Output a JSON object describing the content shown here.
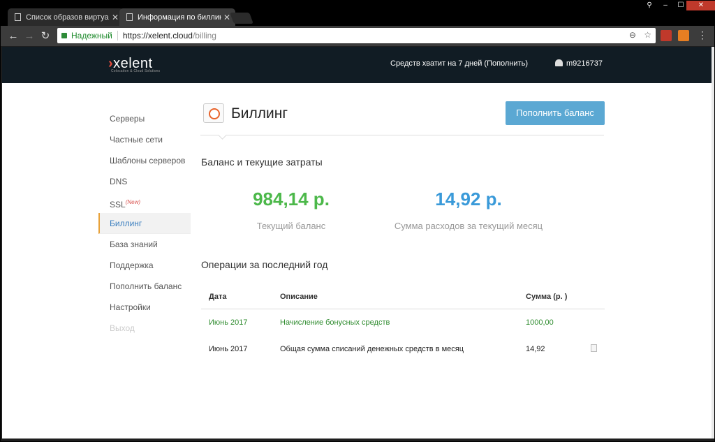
{
  "browser": {
    "tabs": [
      {
        "title": "Список образов виртуа"
      },
      {
        "title": "Информация по биллинг"
      }
    ],
    "secure_label": "Надежный",
    "url_host": "https://xelent.cloud",
    "url_path": "/billing"
  },
  "site": {
    "logo": "xelent",
    "logo_sub": "Colocation & Cloud Solutions",
    "funds_notice": "Средств хватит на 7 дней (Пополнить)",
    "username": "m9216737"
  },
  "sidebar": {
    "items": [
      {
        "label": "Серверы"
      },
      {
        "label": "Частные сети"
      },
      {
        "label": "Шаблоны серверов"
      },
      {
        "label": "DNS"
      },
      {
        "label": "SSL",
        "badge": "(New)"
      },
      {
        "label": "Биллинг"
      },
      {
        "label": "База знаний"
      },
      {
        "label": "Поддержка"
      },
      {
        "label": "Пополнить баланс"
      },
      {
        "label": "Настройки"
      },
      {
        "label": "Выход"
      }
    ]
  },
  "main": {
    "title": "Биллинг",
    "topup_button": "Пополнить баланс",
    "balance_heading": "Баланс и текущие затраты",
    "current_balance": "984,14 р.",
    "current_balance_label": "Текущий баланс",
    "month_spend": "14,92 р.",
    "month_spend_label": "Сумма расходов за текущий месяц",
    "ops_heading": "Операции за последний год",
    "table": {
      "headers": {
        "date": "Дата",
        "desc": "Описание",
        "sum": "Сумма (р. )"
      },
      "rows": [
        {
          "date": "Июнь 2017",
          "desc": "Начисление бонусных средств",
          "sum": "1000,00"
        },
        {
          "date": "Июнь 2017",
          "desc": "Общая сумма списаний денежных средств в месяц",
          "sum": "14,92"
        }
      ]
    }
  },
  "colors": {
    "accent_blue": "#5ba8d3",
    "balance_green": "#4cb84a",
    "spend_blue": "#3a9ad9",
    "header_dark": "#111c24"
  }
}
